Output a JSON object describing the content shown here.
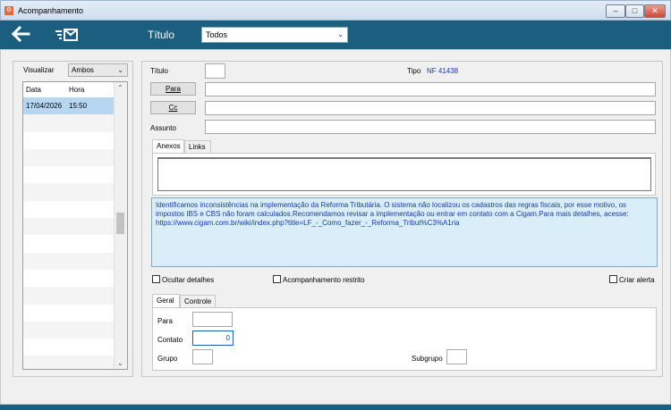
{
  "window": {
    "title": "Acompanhamento",
    "min_glyph": "–",
    "max_glyph": "□",
    "close_glyph": "✕"
  },
  "toolbar": {
    "back_icon": "arrow-left-icon",
    "compose_icon": "list-compose-icon",
    "titulo_label": "Título",
    "titulo_value": "Todos"
  },
  "left": {
    "visualizar_label": "Visualizar",
    "visualizar_value": "Ambos",
    "grid_headers": [
      "Data",
      "Hora"
    ],
    "rows": [
      {
        "data": "17/04/2026",
        "hora": "15:50",
        "selected": true
      }
    ],
    "empty_rows": 15
  },
  "form": {
    "titulo_label": "Título",
    "titulo_value": "",
    "tipo_label": "Tipo",
    "tipo_value": "NF 41438",
    "para_button": "Para",
    "cc_button": "Cc",
    "assunto_label": "Assunto",
    "tabs_top": [
      "Anexos",
      "Links"
    ],
    "details_text": "Identificamos inconsistências na implementação da Reforma Tributária. O sistema não localizou os cadastros das regras fiscais, por esse motivo, os impostos IBS e CBS não foram calculados.Recomendamos revisar a implementação ou entrar em contato com a Cigam.Para mais detalhes, acesse: https://www.cigam.com.br/wiki/index.php?title=LF_-_Como_fazer_-_Reforma_Tribut%C3%A1ria",
    "ocultar_label": "Ocultar detalhes",
    "restrito_label": "Acompanhamento restrito",
    "alerta_label": "Criar alerta",
    "tabs_bottom": [
      "Geral",
      "Controle"
    ],
    "para_label": "Para",
    "contato_label": "Contato",
    "contato_value": "0",
    "grupo_label": "Grupo",
    "subgrupo_label": "Subgrupo"
  },
  "colors": {
    "toolbar": "#1b5e80",
    "accent_text": "#1a3aa0",
    "details_bg": "#d9eef9",
    "selection": "#b6d6f2"
  }
}
